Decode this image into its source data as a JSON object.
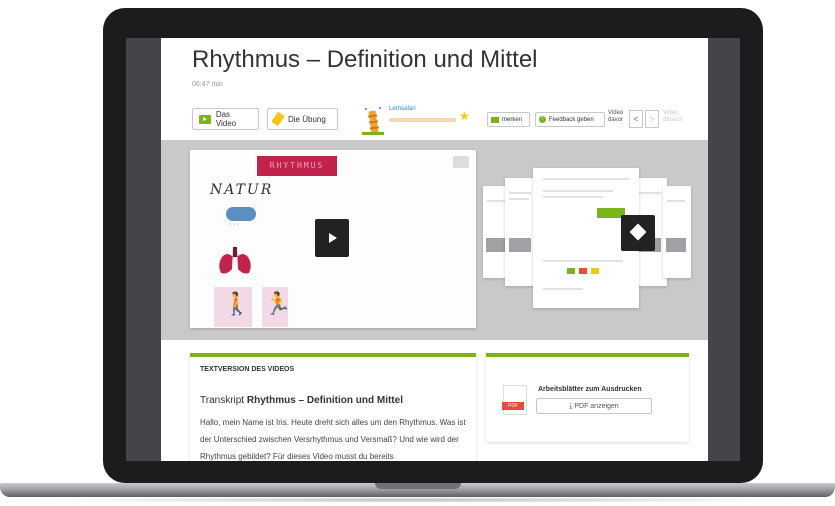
{
  "page": {
    "title": "Rhythmus – Definition und Mittel",
    "duration": "06:47 min"
  },
  "toolbar": {
    "video_label": "Das Video",
    "uebung_label": "Die Übung",
    "lernsafari_label": "Lernsafari",
    "merken_label": "merken",
    "feedback_label": "Feedback geben",
    "video_davor_line1": "Video",
    "video_davor_line2": "davor",
    "prev_arrow": "<",
    "next_arrow": ">",
    "video_danach_line1": "Video",
    "video_danach_line2": "danach"
  },
  "video": {
    "board_title": "RHYTHMUS",
    "board_word": "NATUR",
    "rain_glyphs": "ʼʼʼ"
  },
  "text_version": {
    "heading": "TEXTVERSION DES VIDEOS",
    "transkript_prefix": "Transkript",
    "transkript_title": "Rhythmus – Definition und Mittel",
    "body": "Hallo, mein Name ist Iris. Heute dreht sich alles um den Rhythmus. Was ist der Unterschied zwischen Versrhythmus und Versmaß? Und wie wird der Rhythmus gebildet? Für dieses Video musst du bereits"
  },
  "worksheets": {
    "title": "Arbeitsblätter zum Ausdrucken",
    "button_label": "PDF anzeigen",
    "pdf_tag": "PDF"
  },
  "colors": {
    "accent_green": "#7ab31a",
    "highlight_yellow": "#f4c617",
    "rhythmus_red": "#c0244d",
    "pdf_red": "#e54c3c",
    "link_blue": "#2a8dd4"
  },
  "icons": [
    "video-icon",
    "pencil-icon",
    "tower-icon",
    "star-icon",
    "note-icon",
    "feedback-icon",
    "chevron-left-icon",
    "chevron-right-icon",
    "play-icon",
    "chat-icon",
    "pdf-icon",
    "download-icon"
  ]
}
